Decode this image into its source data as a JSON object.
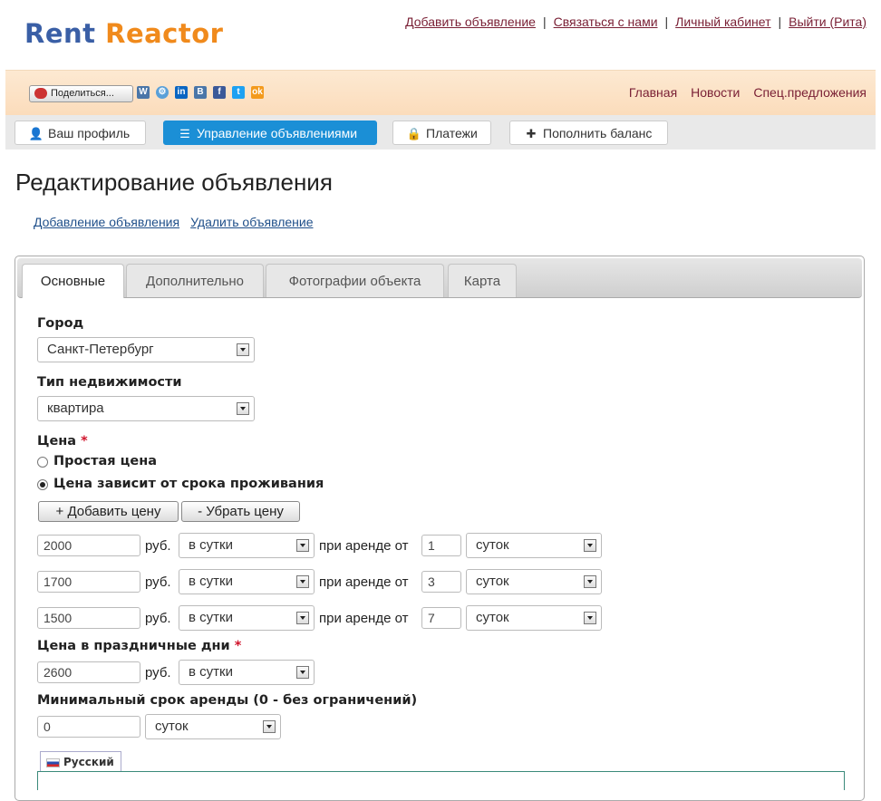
{
  "logo": {
    "part1": "Rent ",
    "part2": "Reactor"
  },
  "toplinks": [
    "Добавить объявление",
    "Связаться с нами",
    "Личный кабинет",
    "Выйти (Рита)"
  ],
  "share": {
    "label": "Поделиться..."
  },
  "social_icons": [
    "vk",
    "settings",
    "in",
    "B",
    "f",
    "t",
    "ok"
  ],
  "mainnav": [
    "Главная",
    "Новости",
    "Спец.предложения"
  ],
  "profile_tabs": [
    {
      "label": "Ваш профиль",
      "icon": "user-icon"
    },
    {
      "label": "Управление объявлениями",
      "icon": "list-icon",
      "active": true
    },
    {
      "label": "Платежи",
      "icon": "lock-icon"
    },
    {
      "label": "Пополнить баланс",
      "icon": "plus-icon"
    }
  ],
  "page_title": "Редактирование объявления",
  "sublinks": [
    "Добавление объявления",
    "Удалить объявление"
  ],
  "panel_tabs": [
    "Основные",
    "Дополнительно",
    "Фотографии объекта",
    "Карта"
  ],
  "form": {
    "city_label": "Город",
    "city_value": "Санкт-Петербург",
    "type_label": "Тип недвижимости",
    "type_value": "квартира",
    "price_label": "Цена",
    "required_mark": "*",
    "radio_simple": "Простая цена",
    "radio_term": "Цена зависит от срока проживания",
    "add_price": "+ Добавить цену",
    "remove_price": "- Убрать цену",
    "currency": "руб.",
    "rent_from": "при аренде от",
    "price_rows": [
      {
        "price": "2000",
        "period": "в сутки",
        "from": "1",
        "unit": "суток"
      },
      {
        "price": "1700",
        "period": "в сутки",
        "from": "3",
        "unit": "суток"
      },
      {
        "price": "1500",
        "period": "в сутки",
        "from": "7",
        "unit": "суток"
      }
    ],
    "holiday_label": "Цена в праздничные дни",
    "holiday_price": "2600",
    "holiday_period": "в сутки",
    "min_term_label": "Минимальный срок аренды (0 - без ограничений)",
    "min_term_value": "0",
    "min_term_unit": "суток",
    "lang_tab": "Русский"
  }
}
